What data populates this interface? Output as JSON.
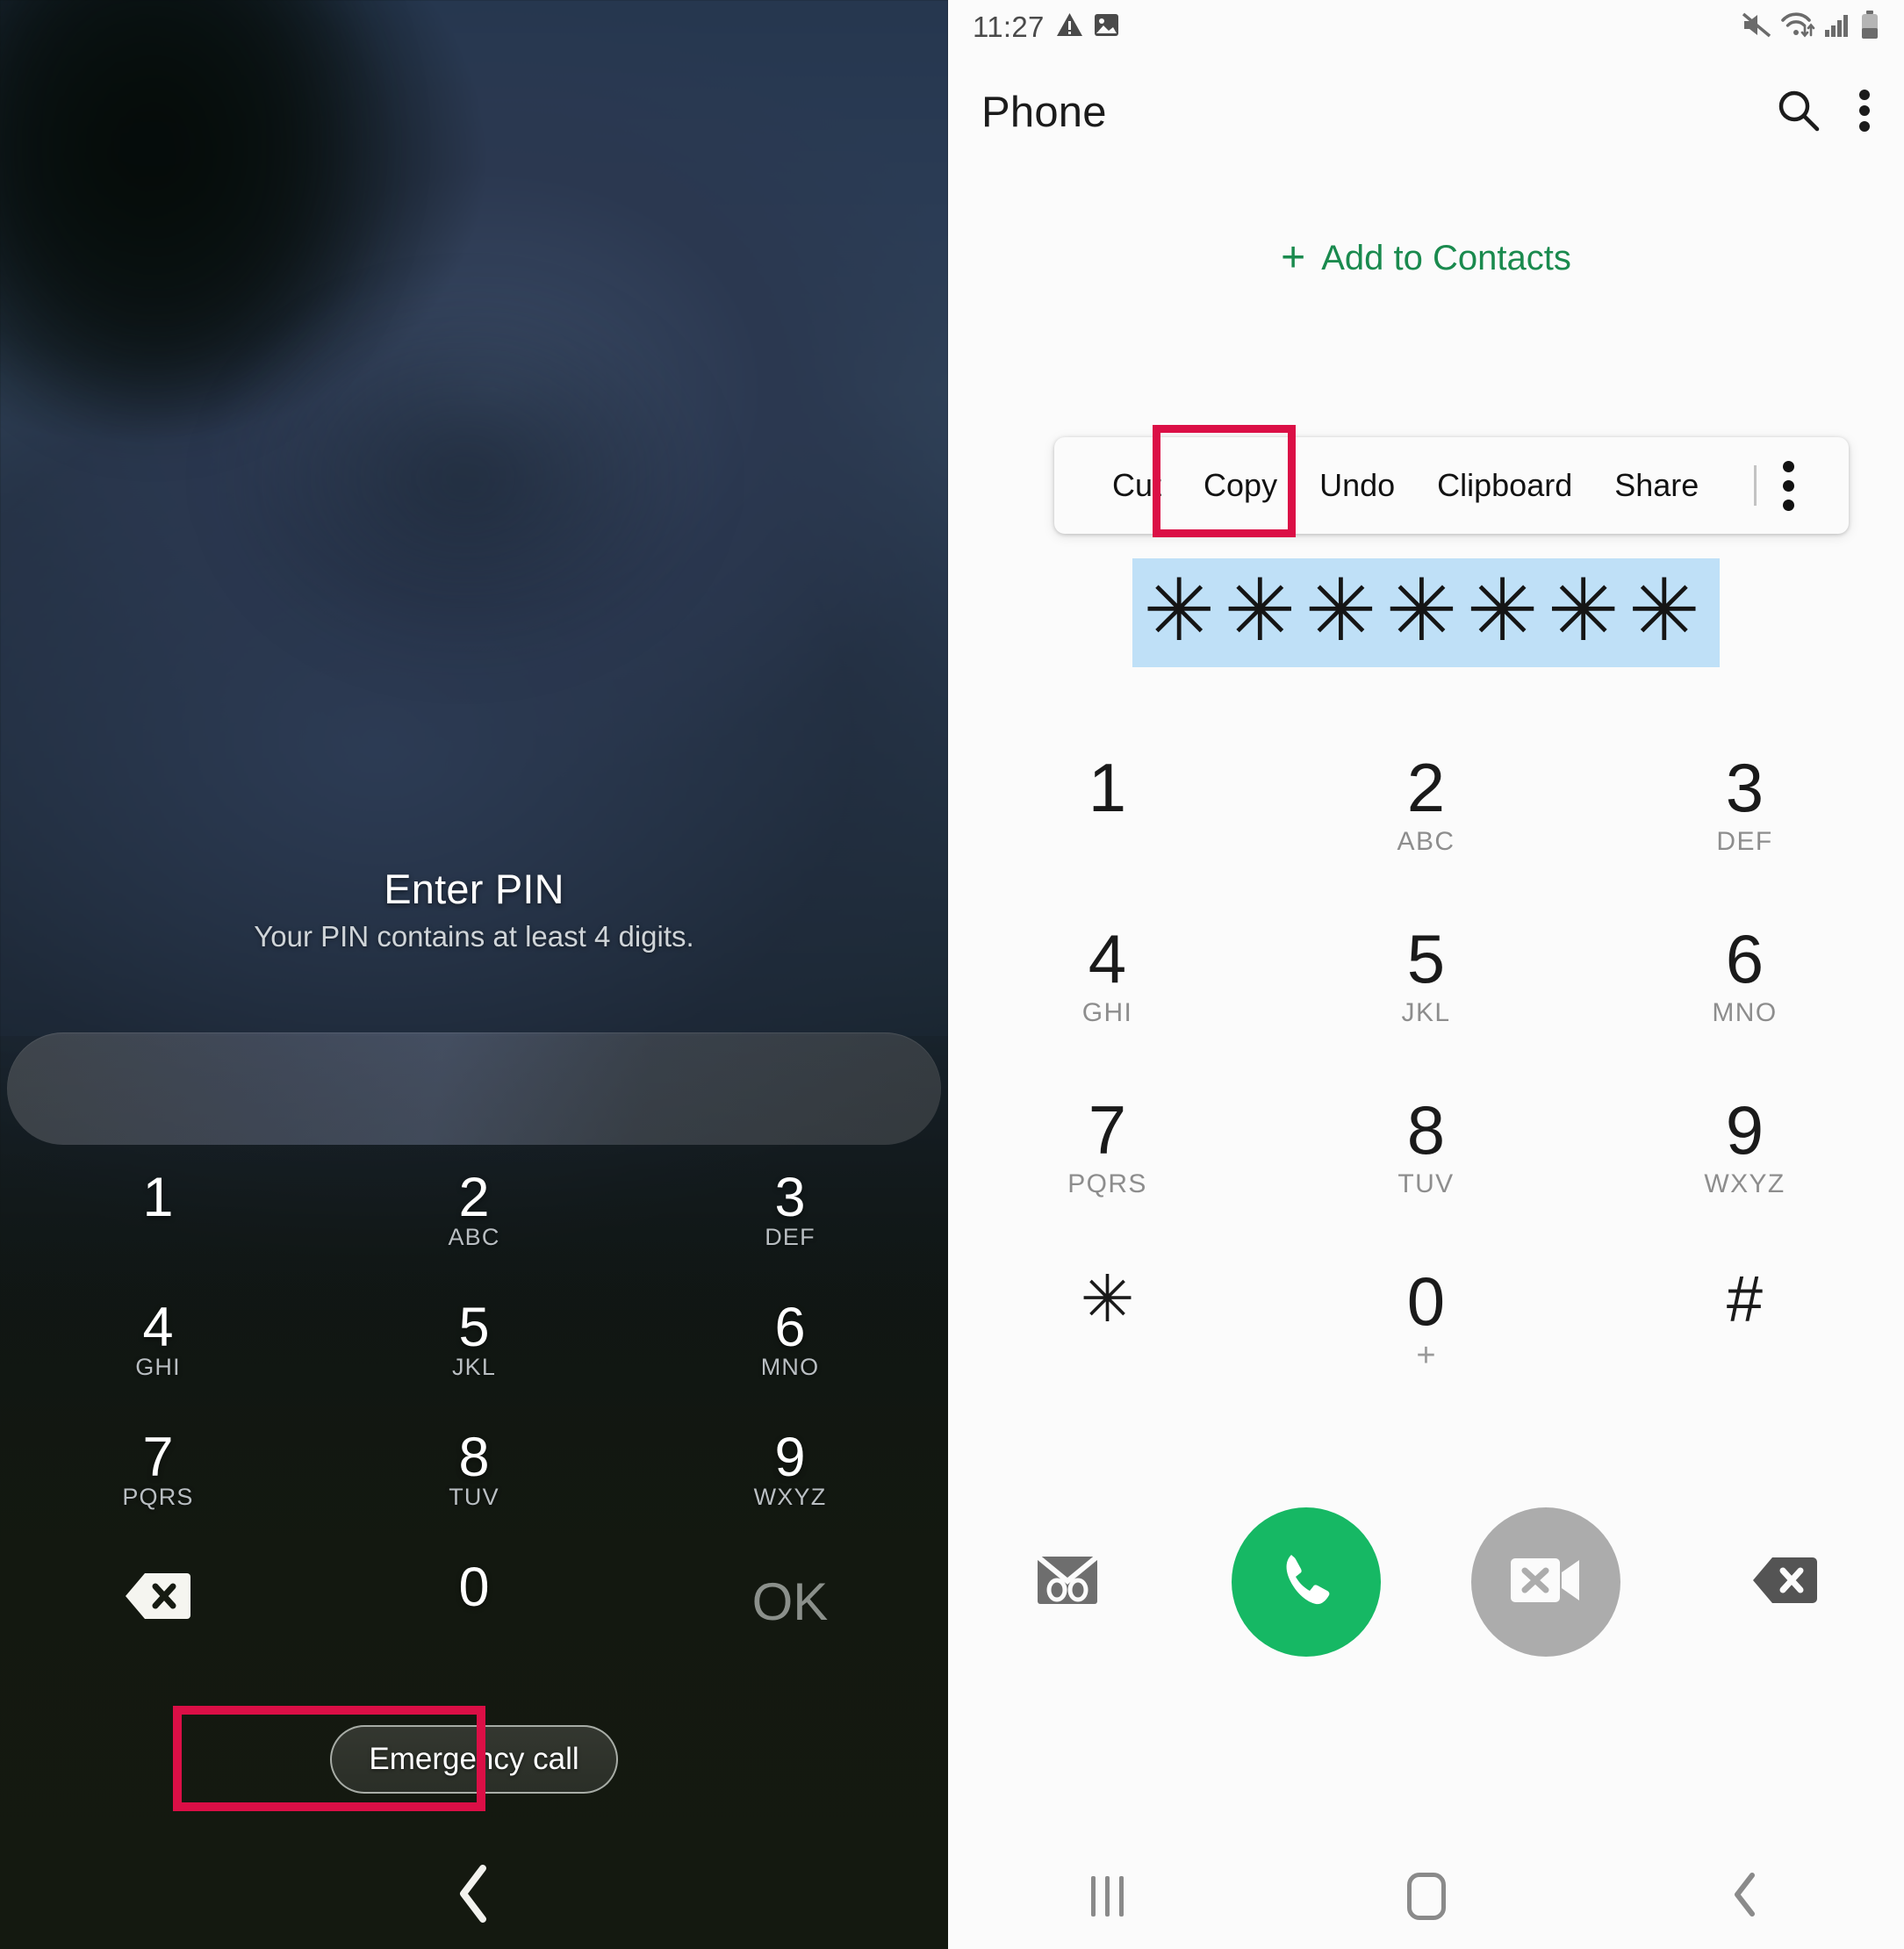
{
  "lock_screen": {
    "title": "Enter PIN",
    "subtitle": "Your PIN contains at least 4 digits.",
    "pin_input_value": "",
    "keypad": [
      {
        "num": "1",
        "sub": ""
      },
      {
        "num": "2",
        "sub": "ABC"
      },
      {
        "num": "3",
        "sub": "DEF"
      },
      {
        "num": "4",
        "sub": "GHI"
      },
      {
        "num": "5",
        "sub": "JKL"
      },
      {
        "num": "6",
        "sub": "MNO"
      },
      {
        "num": "7",
        "sub": "PQRS"
      },
      {
        "num": "8",
        "sub": "TUV"
      },
      {
        "num": "9",
        "sub": "WXYZ"
      },
      {
        "num": "0",
        "sub": ""
      }
    ],
    "backspace_icon": "backspace-icon",
    "ok_label": "OK",
    "emergency_call_label": "Emergency call",
    "nav_back_icon": "back-chevron-icon"
  },
  "phone_app": {
    "status_bar": {
      "time": "11:27",
      "left_icons": [
        "warning-triangle-icon",
        "image-icon"
      ],
      "right_icons": [
        "mute-icon",
        "wifi-icon",
        "signal-bars-icon",
        "battery-icon"
      ]
    },
    "header": {
      "title": "Phone",
      "search_icon": "search-icon",
      "overflow_icon": "overflow-menu-icon"
    },
    "add_to_contacts": {
      "plus": "+",
      "label": "Add to Contacts"
    },
    "context_menu": {
      "items": [
        "Cut",
        "Copy",
        "Undo",
        "Clipboard",
        "Share"
      ],
      "overflow_icon": "overflow-menu-icon"
    },
    "number_field": {
      "value": "✳✳✳✳✳✳✳",
      "selected": true,
      "selection_color": "#BFE0F7",
      "handle_color": "#3080E8"
    },
    "dialpad": [
      {
        "num": "1",
        "sub": ""
      },
      {
        "num": "2",
        "sub": "ABC"
      },
      {
        "num": "3",
        "sub": "DEF"
      },
      {
        "num": "4",
        "sub": "GHI"
      },
      {
        "num": "5",
        "sub": "JKL"
      },
      {
        "num": "6",
        "sub": "MNO"
      },
      {
        "num": "7",
        "sub": "PQRS"
      },
      {
        "num": "8",
        "sub": "TUV"
      },
      {
        "num": "9",
        "sub": "WXYZ"
      },
      {
        "num": "✳",
        "sub": ""
      },
      {
        "num": "0",
        "sub": "+"
      },
      {
        "num": "#",
        "sub": ""
      }
    ],
    "actions": {
      "voicemail_icon": "voicemail-icon",
      "call_icon": "call-icon",
      "call_color": "#16B864",
      "video_call_icon": "video-call-disabled-icon",
      "video_color": "#ACACAC",
      "backspace_icon": "backspace-icon"
    },
    "nav_bar": {
      "recents_icon": "recents-icon",
      "home_icon": "home-icon",
      "back_icon": "back-chevron-icon"
    }
  },
  "annotations": {
    "highlight_color": "#DB0F46",
    "boxes": [
      "copy-menu-item",
      "emergency-call-button"
    ]
  }
}
